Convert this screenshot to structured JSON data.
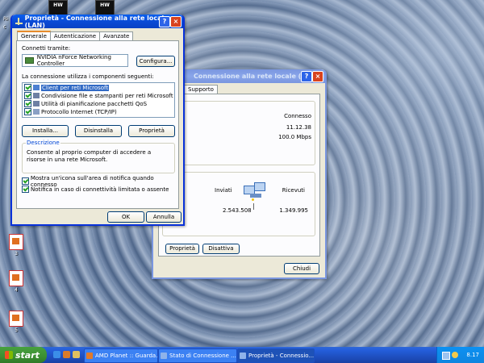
{
  "desktop": {
    "top_icon1": "HW",
    "top_icon2": "HW",
    "top_label": "Ri",
    "top_label2": "c",
    "icons": [
      {
        "label": "3"
      },
      {
        "label": "4"
      },
      {
        "label": "5"
      }
    ]
  },
  "main_dialog": {
    "title": "Proprietà - Connessione alla rete locale (LAN)",
    "tabs": [
      "Generale",
      "Autenticazione",
      "Avanzate"
    ],
    "connect_using_label": "Connetti tramite:",
    "adapter": "NVIDIA nForce Networking Controller",
    "configure_button": "Configura...",
    "components_label": "La connessione utilizza i componenti seguenti:",
    "components": [
      {
        "label": "Client per reti Microsoft",
        "checked": true,
        "selected": true
      },
      {
        "label": "Condivisione file e stampanti per reti Microsoft",
        "checked": true,
        "selected": false
      },
      {
        "label": "Utilità di pianificazione pacchetti QoS",
        "checked": true,
        "selected": false
      },
      {
        "label": "Protocollo Internet (TCP/IP)",
        "checked": true,
        "selected": false
      }
    ],
    "install_button": "Installa...",
    "uninstall_button": "Disinstalla",
    "properties_button": "Proprietà",
    "description_title": "Descrizione",
    "description_text": "Consente al proprio computer di accedere a risorse in una rete Microsoft.",
    "show_icon_label": "Mostra un'icona sull'area di notifica quando connesso",
    "notify_label": "Notifica in caso di connettività limitata o assente",
    "ok_button": "OK",
    "cancel_button": "Annulla"
  },
  "status_dialog": {
    "title": "Connessione alla rete locale (LAN)",
    "tab_support": "Supporto",
    "connection_group": "sione",
    "status_value": "Connesso",
    "duration_value": "11.12.38",
    "speed_value": "100.0 Mbps",
    "sent_label": "Inviati",
    "received_label": "Ricevuti",
    "packets_label": "etti",
    "sent_value": "2.543.508",
    "received_value": "1.349.995",
    "properties_button": "Proprietà",
    "disable_button": "Disattiva",
    "close_button": "Chiudi"
  },
  "taskbar": {
    "start_label": "start",
    "buttons": [
      "AMD Planet :: Guarda...",
      "Stato di Connessione ...",
      "Proprietà - Connessio..."
    ],
    "clock": "8.17"
  },
  "colors": {
    "xp_blue": "#0831d9",
    "dialog_bg": "#ece9d8",
    "start_green": "#3c8f33",
    "selection": "#316ac5"
  }
}
